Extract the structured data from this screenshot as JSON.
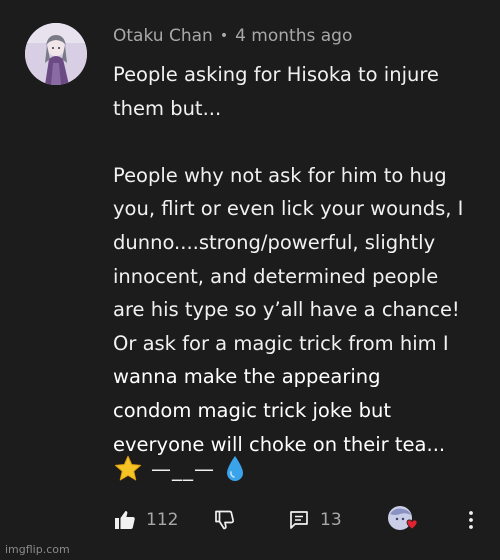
{
  "comment": {
    "author": "Otaku Chan",
    "separator": "•",
    "time": "4 months ago",
    "lines": [
      "People asking for Hisoka to injure",
      "them but...",
      "",
      "People why not ask for him to hug",
      "you, flirt or even lick your wounds, I",
      "dunno....strong/powerful, slightly",
      "innocent, and determined people",
      "are his type so y’all have a chance!",
      "Or ask for a magic trick from him I",
      "wanna make the appearing",
      "condom magic trick joke but",
      "everyone will choke on their tea..."
    ],
    "emoji_dash": "—__—",
    "likes": "112",
    "replies": "13"
  },
  "watermark": "imgflip.com",
  "colors": {
    "background": "#1c1c1c",
    "text": "#f1f1f1",
    "secondary_text": "#a8a8a8",
    "heart": "#e0232e",
    "star": "#f6c425",
    "droplet": "#3aa3ea"
  },
  "icons": {
    "like": "thumbs-up-icon",
    "dislike": "thumbs-down-icon",
    "reply": "reply-icon",
    "creator_heart": "creator-heart-icon",
    "menu": "more-vertical-icon"
  }
}
